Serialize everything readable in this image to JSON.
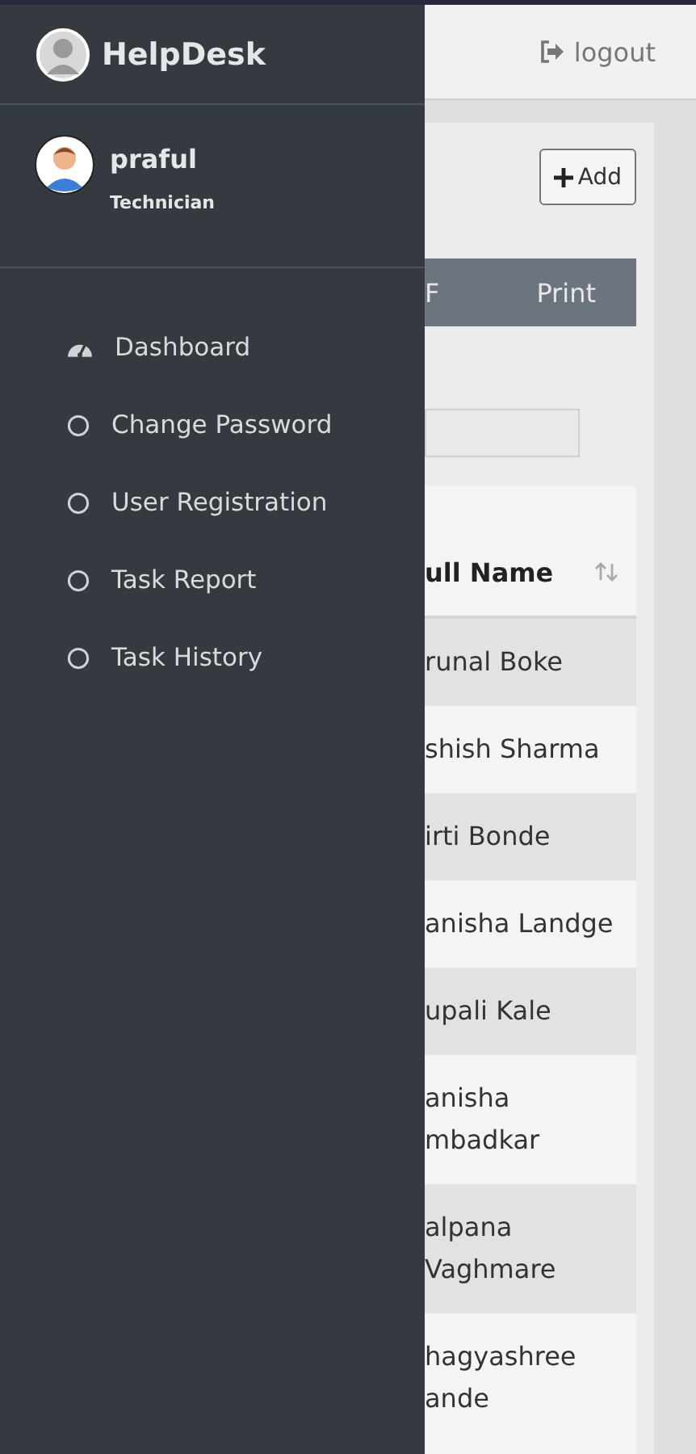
{
  "sidebar": {
    "brand": "HelpDesk",
    "user": {
      "name": "praful",
      "role": "Technician"
    },
    "items": [
      {
        "label": "Dashboard",
        "kind": "dashboard",
        "selected": false
      },
      {
        "label": "Change Password",
        "kind": "circle",
        "selected": false
      },
      {
        "label": "User Registration",
        "kind": "circle",
        "selected": false
      },
      {
        "label": "Task Report",
        "kind": "circle",
        "selected": false
      },
      {
        "label": "Task History",
        "kind": "circle",
        "selected": false
      }
    ]
  },
  "header": {
    "logout": "logout"
  },
  "toolbar": {
    "add": "Add",
    "export_buttons": [
      "F",
      "Print"
    ]
  },
  "table": {
    "columns": [
      "ull Name"
    ],
    "rows": [
      "runal Boke",
      "shish Sharma",
      "irti Bonde",
      "anisha Landge",
      "upali Kale",
      "anisha\nmbadkar",
      "alpana\nVaghmare",
      "hagyashree\nande"
    ]
  }
}
